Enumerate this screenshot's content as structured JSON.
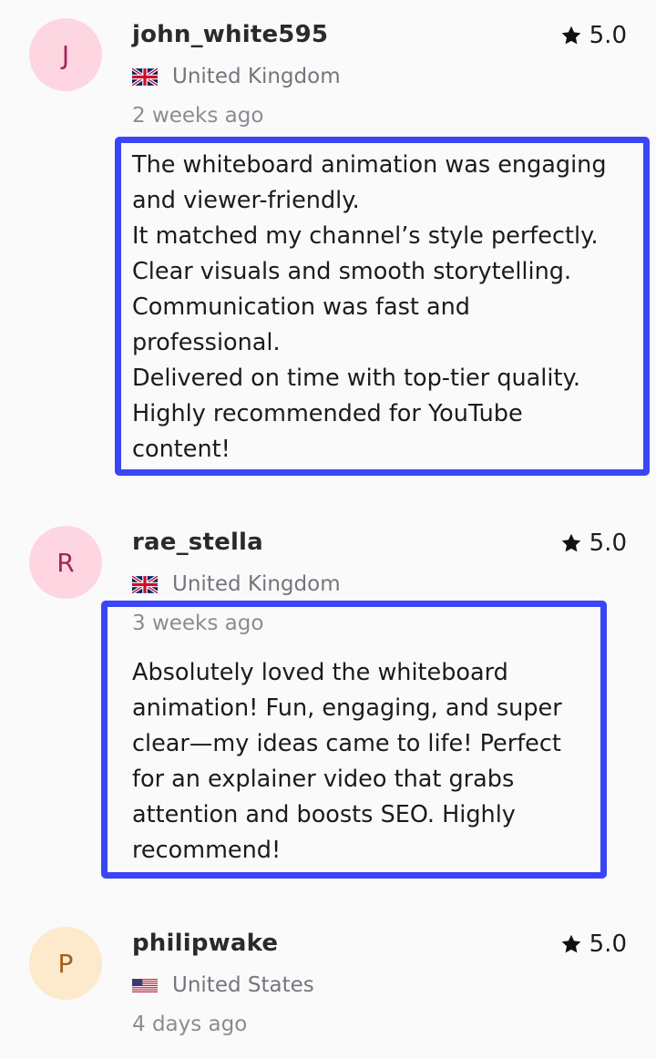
{
  "reviews": [
    {
      "initial": "J",
      "username": "john_white595",
      "rating": "5.0",
      "flag_icon": "uk-flag-icon",
      "country": "United Kingdom",
      "time": "2 weeks ago",
      "text": "The whiteboard animation was engaging\nand viewer-friendly.\nIt matched my channel’s style perfectly.\nClear visuals and smooth storytelling.\nCommunication was fast and\nprofessional.\nDelivered on time with top-tier quality.\nHighly recommended for YouTube\ncontent!",
      "avatar_bg": "#fdd6e2",
      "avatar_fg": "#a3245a"
    },
    {
      "initial": "R",
      "username": "rae_stella",
      "rating": "5.0",
      "flag_icon": "uk-flag-icon",
      "country": "United Kingdom",
      "time": "3 weeks ago",
      "text": "Absolutely loved the whiteboard\nanimation! Fun, engaging, and super\nclear—my ideas came to life! Perfect\nfor an explainer video that grabs\nattention and boosts SEO. Highly\nrecommend!",
      "avatar_bg": "#fdd6e2",
      "avatar_fg": "#a3245a"
    },
    {
      "initial": "P",
      "username": "philipwake",
      "rating": "5.0",
      "flag_icon": "us-flag-icon",
      "country": "United States",
      "time": "4 days ago",
      "avatar_bg": "#fde9cc",
      "avatar_fg": "#a0611a"
    }
  ],
  "colors": {
    "highlight": "#3a46f5",
    "muted_text": "#74767e"
  }
}
